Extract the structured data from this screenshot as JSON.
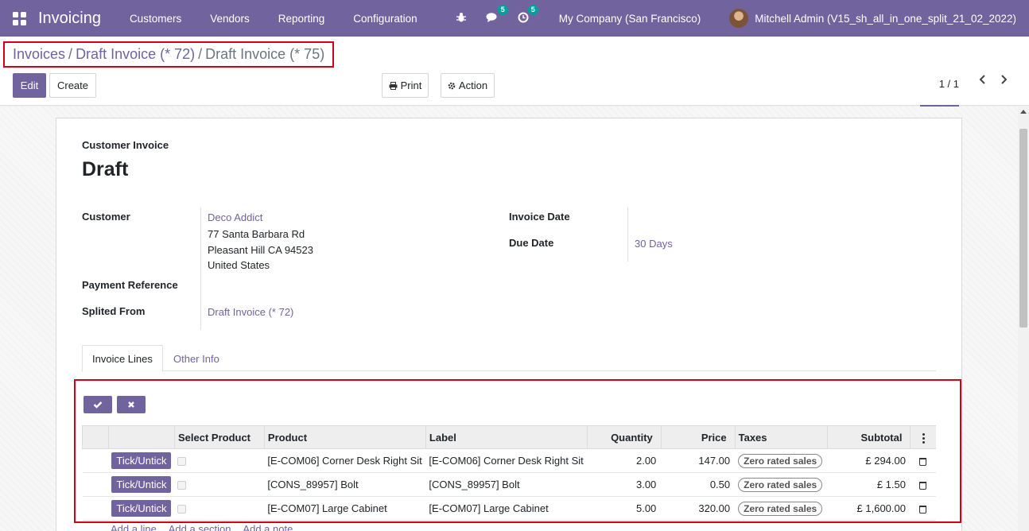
{
  "navbar": {
    "app_name": "Invoicing",
    "menu": [
      "Customers",
      "Vendors",
      "Reporting",
      "Configuration"
    ],
    "messages_count": "5",
    "activities_count": "5",
    "company": "My Company (San Francisco)",
    "user": "Mitchell Admin (V15_sh_all_in_one_split_21_02_2022)"
  },
  "breadcrumb": {
    "items": [
      "Invoices",
      "Draft Invoice (* 72)"
    ],
    "current": "Draft Invoice (* 75)",
    "sep": "/"
  },
  "toolbar": {
    "edit": "Edit",
    "create": "Create",
    "print": "Print",
    "action": "Action",
    "pager": "1 / 1"
  },
  "form": {
    "subtitle": "Customer Invoice",
    "title": "Draft",
    "customer_label": "Customer",
    "customer_name": "Deco Addict",
    "address": [
      "77 Santa Barbara Rd",
      "Pleasant Hill CA 94523",
      "United States"
    ],
    "payment_ref_label": "Payment Reference",
    "splited_from_label": "Splited From",
    "splited_from": "Draft Invoice (* 72)",
    "invoice_date_label": "Invoice Date",
    "due_date_label": "Due Date",
    "due_date": "30 Days"
  },
  "tabs": [
    "Invoice Lines",
    "Other Info"
  ],
  "lines": {
    "columns": {
      "select": "Select Product",
      "product": "Product",
      "label": "Label",
      "quantity": "Quantity",
      "price": "Price",
      "taxes": "Taxes",
      "subtotal": "Subtotal"
    },
    "tick_label": "Tick/Untick",
    "rows": [
      {
        "product": "[E-COM06] Corner Desk Right Sit",
        "label": "[E-COM06] Corner Desk Right Sit",
        "quantity": "2.00",
        "price": "147.00",
        "tax": "Zero rated sales",
        "subtotal": "£ 294.00"
      },
      {
        "product": "[CONS_89957] Bolt",
        "label": "[CONS_89957] Bolt",
        "quantity": "3.00",
        "price": "0.50",
        "tax": "Zero rated sales",
        "subtotal": "£ 1.50"
      },
      {
        "product": "[E-COM07] Large Cabinet",
        "label": "[E-COM07] Large Cabinet",
        "quantity": "5.00",
        "price": "320.00",
        "tax": "Zero rated sales",
        "subtotal": "£ 1,600.00"
      }
    ],
    "add_links": [
      "Add a line",
      "Add a section",
      "Add a note"
    ]
  },
  "colors": {
    "brand": "#71639e",
    "highlight": "#d0021b",
    "badge": "#00a09d"
  }
}
